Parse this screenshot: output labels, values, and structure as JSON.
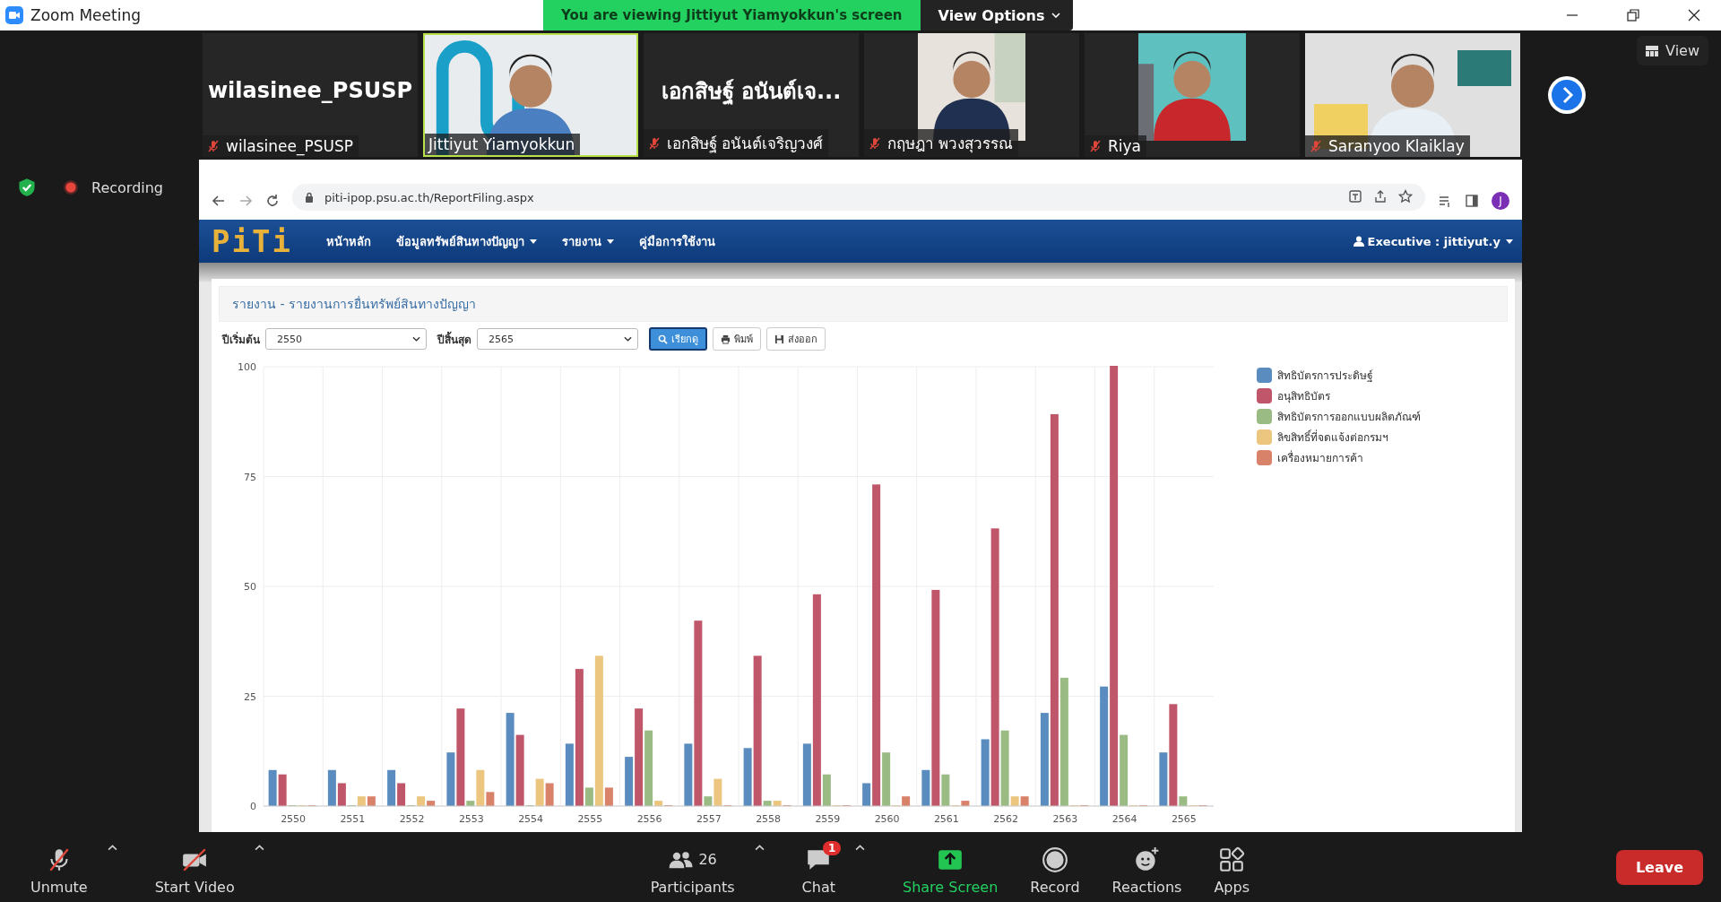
{
  "window": {
    "title": "Zoom Meeting"
  },
  "share_banner": {
    "text": "You are viewing Jittiyut Yiamyokkun's screen",
    "view_options": "View Options"
  },
  "participants": [
    {
      "kind": "name",
      "tile_text": "wilasinee_PSUSP",
      "name": "wilasinee_PSUSP",
      "muted": true,
      "speaking": false
    },
    {
      "kind": "video",
      "name": "Jittiyut Yiamyokkun",
      "muted": false,
      "speaking": true
    },
    {
      "kind": "name",
      "tile_text": "เอกสิษฐ์ อนันต์เจ...",
      "name": "เอกสิษฐ์ อนันต์เจริญวงศ์",
      "muted": true,
      "speaking": false
    },
    {
      "name": "กฤษฎา พวงสุวรรณ",
      "muted": true,
      "speaking": false
    },
    {
      "name": "Riya",
      "muted": true,
      "speaking": false
    },
    {
      "kind": "video",
      "name": "Saranyoo Klaiklay",
      "muted": true,
      "speaking": false
    }
  ],
  "view_button": "View",
  "recording": {
    "label": "Recording"
  },
  "browser": {
    "url": "piti-ipop.psu.ac.th/ReportFiling.aspx",
    "avatar": "J"
  },
  "site": {
    "logo": "PiTi",
    "nav": [
      {
        "label": "หน้าหลัก",
        "dropdown": false
      },
      {
        "label": "ข้อมูลทรัพย์สินทางปัญญา",
        "dropdown": true
      },
      {
        "label": "รายงาน",
        "dropdown": true
      },
      {
        "label": "คู่มือการใช้งาน",
        "dropdown": false
      }
    ],
    "user": "Executive : jittiyut.y"
  },
  "report": {
    "title": "รายงาน - รายงานการยื่นทรัพย์สินทางปัญญา",
    "filters": [
      {
        "label": "ปีเริ่มต้น",
        "value": "2550"
      },
      {
        "label": "ปีสิ้นสุด",
        "value": "2565"
      }
    ],
    "buttons": [
      {
        "label": "เรียกดู",
        "kind": "search"
      },
      {
        "label": "พิมพ์",
        "kind": "print"
      },
      {
        "label": "ส่งออก",
        "kind": "export"
      }
    ],
    "chart_data": {
      "type": "bar",
      "categories": [
        "2550",
        "2551",
        "2552",
        "2553",
        "2554",
        "2555",
        "2556",
        "2557",
        "2558",
        "2559",
        "2560",
        "2561",
        "2562",
        "2563",
        "2564",
        "2565"
      ],
      "ylim": [
        0,
        100
      ],
      "grid": true,
      "yticks": [
        0,
        25,
        50,
        75,
        100
      ],
      "series": [
        {
          "name": "สิทธิบัตรการประดิษฐ์",
          "color": "#5b8cc0",
          "values": [
            8,
            8,
            8,
            12,
            21,
            14,
            11,
            14,
            13,
            14,
            5,
            8,
            15,
            21,
            27,
            12
          ]
        },
        {
          "name": "อนุสิทธิบัตร",
          "color": "#c0566a",
          "values": [
            7,
            5,
            5,
            22,
            16,
            31,
            22,
            42,
            34,
            48,
            73,
            49,
            63,
            89,
            100,
            23
          ]
        },
        {
          "name": "สิทธิบัตรการออกแบบผลิตภัณฑ์",
          "color": "#9bbb84",
          "values": [
            0,
            0,
            0,
            1,
            0,
            4,
            17,
            2,
            1,
            7,
            12,
            7,
            17,
            29,
            16,
            2
          ]
        },
        {
          "name": "ลิขสิทธิ์ที่จดแจ้งต่อกรมฯ",
          "color": "#ecc67f",
          "values": [
            0,
            2,
            2,
            8,
            6,
            34,
            1,
            6,
            1,
            0,
            0,
            0,
            2,
            0,
            0,
            0
          ]
        },
        {
          "name": "เครื่องหมายการค้า",
          "color": "#d9826a",
          "values": [
            0,
            2,
            1,
            3,
            5,
            4,
            0,
            0,
            0,
            0,
            2,
            1,
            2,
            0,
            0,
            0
          ]
        }
      ]
    }
  },
  "toolbar": {
    "items": [
      {
        "kind": "mic",
        "label": "Unmute",
        "caret": true
      },
      {
        "kind": "video",
        "label": "Start Video",
        "caret": true
      },
      {
        "kind": "participants",
        "label": "Participants",
        "count": "26",
        "caret": true
      },
      {
        "kind": "chat",
        "label": "Chat",
        "badge": "1",
        "caret": true
      },
      {
        "kind": "share",
        "label": "Share Screen",
        "caret": false
      },
      {
        "kind": "record",
        "label": "Record",
        "caret": false
      },
      {
        "kind": "reactions",
        "label": "Reactions",
        "caret": false
      },
      {
        "kind": "apps",
        "label": "Apps",
        "caret": false
      }
    ],
    "leave": "Leave"
  }
}
